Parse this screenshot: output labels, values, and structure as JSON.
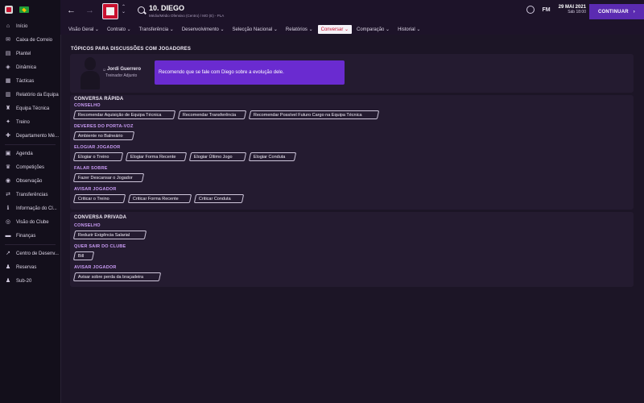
{
  "sidebar": {
    "items": [
      {
        "label": "Início",
        "icon": "home-icon"
      },
      {
        "label": "Caixa de Correio",
        "icon": "mail-icon"
      },
      {
        "label": "Plantel",
        "icon": "squad-icon"
      },
      {
        "label": "Dinâmica",
        "icon": "dynamics-icon"
      },
      {
        "label": "Tácticas",
        "icon": "tactics-icon"
      },
      {
        "label": "Relatório da Equipa",
        "icon": "report-icon"
      },
      {
        "label": "Equipa Técnica",
        "icon": "staff-icon"
      },
      {
        "label": "Treino",
        "icon": "training-icon"
      },
      {
        "label": "Departamento Mé...",
        "icon": "medical-icon"
      },
      {
        "label": "Agenda",
        "icon": "calendar-icon"
      },
      {
        "label": "Competições",
        "icon": "trophy-icon"
      },
      {
        "label": "Observação",
        "icon": "scouting-icon"
      },
      {
        "label": "Transferências",
        "icon": "transfers-icon"
      },
      {
        "label": "Informação do Cl...",
        "icon": "info-icon"
      },
      {
        "label": "Visão do Clube",
        "icon": "vision-icon"
      },
      {
        "label": "Finanças",
        "icon": "finances-icon"
      },
      {
        "label": "Centro de Desenv...",
        "icon": "development-icon"
      },
      {
        "label": "Reservas",
        "icon": "reserves-icon"
      },
      {
        "label": "Sub-20",
        "icon": "u20-icon"
      }
    ]
  },
  "header": {
    "player_title": "10. DIEGO",
    "player_subtitle": "Médio/Médio Ofensivo (Centro) / MO (E) - PLA",
    "date": "29 MAI 2021",
    "time": "Sáb 18:00",
    "fm_label": "FM",
    "continue_label": "CONTINUAR"
  },
  "tabs": [
    {
      "label": "Visão Geral ⌄",
      "active": false
    },
    {
      "label": "Contrato ⌄",
      "active": false
    },
    {
      "label": "Transferência ⌄",
      "active": false
    },
    {
      "label": "Desenvolvimento ⌄",
      "active": false
    },
    {
      "label": "Selecção Nacional ⌄",
      "active": false
    },
    {
      "label": "Relatórios ⌄",
      "active": false
    },
    {
      "label": "Conversar ⌄",
      "active": true
    },
    {
      "label": "Comparação ⌄",
      "active": false
    },
    {
      "label": "Historial ⌄",
      "active": false
    }
  ],
  "discussion": {
    "title": "TÓPICOS PARA DISCUSSÕES COM JOGADORES",
    "coach_name": "Jordi Guerrero",
    "coach_role": "Treinador Adjunto",
    "message": "Recomendo que se fale com Diego sobre a evolução dele."
  },
  "quick": {
    "title": "CONVERSA RÁPIDA",
    "groups": [
      {
        "label": "CONSELHO",
        "buttons": [
          "Recomendar Aquisição de Equipa Técnica",
          "Recomendar Transferência",
          "Recomendar Possível Futuro Cargo na Equipa Técnica"
        ]
      },
      {
        "label": "DEVERES DO PORTA-VOZ",
        "buttons": [
          "Ambiente no Balneário"
        ]
      },
      {
        "label": "ELOGIAR JOGADOR",
        "buttons": [
          "Elogiar o Treino",
          "Elogiar Forma Recente",
          "Elogiar Último Jogo",
          "Elogiar Conduta"
        ]
      },
      {
        "label": "FALAR SOBRE",
        "buttons": [
          "Fazer Descansar o Jogador"
        ]
      },
      {
        "label": "AVISAR JOGADOR",
        "buttons": [
          "Criticar o Treino",
          "Criticar Forma Recente",
          "Criticar Conduta"
        ]
      }
    ]
  },
  "private": {
    "title": "CONVERSA PRIVADA",
    "groups": [
      {
        "label": "CONSELHO",
        "buttons": [
          "Reduzir Exigência Salarial"
        ]
      },
      {
        "label": "QUER SAIR DO CLUBE",
        "buttons": [
          "Bill"
        ]
      },
      {
        "label": "AVISAR JOGADOR",
        "buttons": [
          "Avisar sobre perda da braçadeira"
        ]
      }
    ]
  }
}
